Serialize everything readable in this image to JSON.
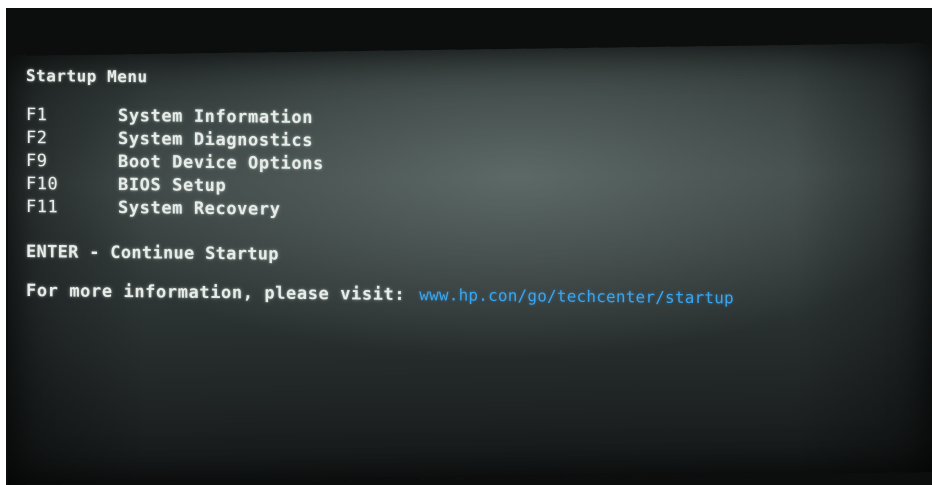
{
  "title": "Startup Menu",
  "menu": [
    {
      "key": "F1",
      "label": "System Information"
    },
    {
      "key": "F2",
      "label": "System Diagnostics"
    },
    {
      "key": "F9",
      "label": "Boot Device Options"
    },
    {
      "key": "F10",
      "label": "BIOS Setup"
    },
    {
      "key": "F11",
      "label": "System Recovery"
    }
  ],
  "enter_line": "ENTER - Continue Startup",
  "info": {
    "text": "For more information, please visit:",
    "link": "www.hp.con/go/techcenter/startup"
  },
  "colors": {
    "text": "#e7ece8",
    "link": "#3aa6ee"
  }
}
